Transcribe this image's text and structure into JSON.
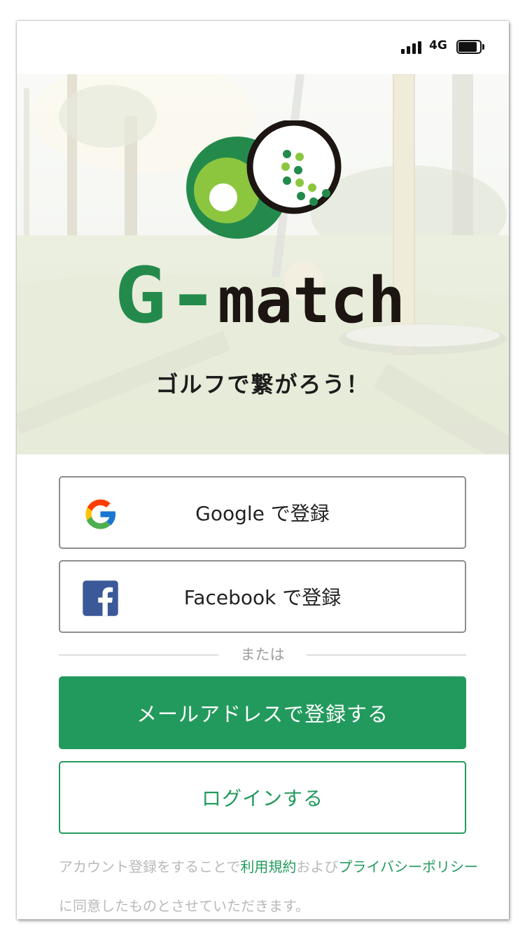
{
  "status_bar": {
    "network": "4G"
  },
  "hero": {
    "app_name_prefix": "G-",
    "app_name_suffix": "match",
    "tagline": "ゴルフで繋がろう！"
  },
  "signup": {
    "google_label": "Google で登録",
    "facebook_label": "Facebook で登録",
    "divider_text": "または",
    "email_label": "メールアドレスで登録する",
    "login_label": "ログインする"
  },
  "terms": {
    "prefix": "アカウント登録をすることで",
    "terms_link": "利用規約",
    "middle": "および",
    "privacy_link": "プライバシーポリシー",
    "suffix": "に同意したものとさせていただきます。"
  },
  "colors": {
    "brand_green": "#239a5d",
    "logo_dark_green": "#238a4c",
    "logo_light_green": "#8cc63f",
    "facebook_blue": "#3b5998"
  },
  "icons": [
    "signal-icon",
    "battery-icon",
    "google-icon",
    "facebook-icon",
    "golf-ball-logo"
  ]
}
